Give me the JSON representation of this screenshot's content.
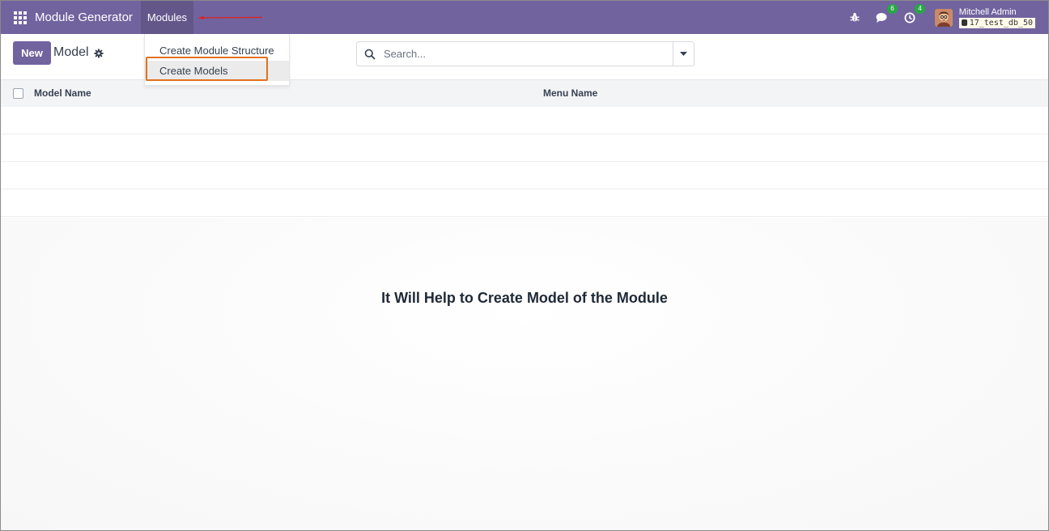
{
  "navbar": {
    "app_title": "Module Generator",
    "menu_item": "Modules",
    "messages_count": "6",
    "activities_count": "4",
    "user_name": "Mitchell Admin",
    "database": "17_test_db_50",
    "color": "#71639e"
  },
  "dropdown": {
    "items": [
      {
        "label": "Create Module Structure"
      },
      {
        "label": "Create Models"
      }
    ],
    "highlight_color": "#e2701d"
  },
  "control_panel": {
    "new_label": "New",
    "title": "Model",
    "search_placeholder": "Search..."
  },
  "table": {
    "columns": [
      "Model Name",
      "Menu Name"
    ]
  },
  "empty_state": {
    "message": "It Will Help to Create Model of the Module"
  },
  "icons": [
    "apps-icon",
    "bug-icon",
    "chat-icon",
    "clock-icon",
    "gear-icon",
    "search-icon",
    "caret-down-icon",
    "database-icon"
  ]
}
